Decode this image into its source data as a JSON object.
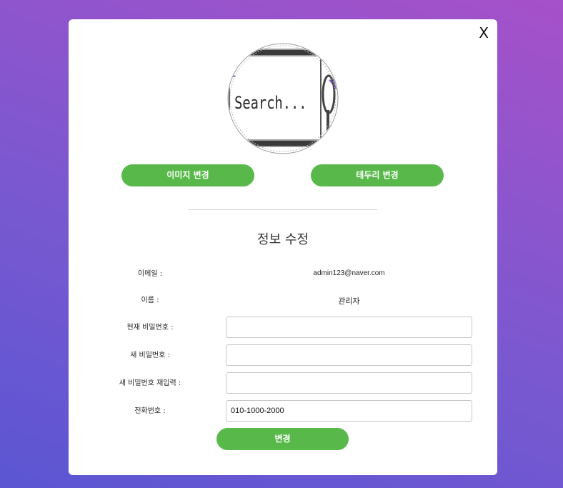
{
  "modal": {
    "close_label": "X",
    "avatar_text": "Search...",
    "change_image_label": "이미지 변경",
    "change_border_label": "테두리 변경",
    "section_title": "정보 수정",
    "fields": {
      "email_label": "이메일 :",
      "email_value": "admin123@naver.com",
      "name_label": "이름 :",
      "name_value": "관리자",
      "current_password_label": "현재 비밀번호 :",
      "current_password_value": "",
      "new_password_label": "새 비밀번호 :",
      "new_password_value": "",
      "confirm_password_label": "새 비밀번호 재입력 :",
      "confirm_password_value": "",
      "phone_label": "전화번호 :",
      "phone_value": "010-1000-2000"
    },
    "submit_label": "변경"
  },
  "colors": {
    "accent_green": "#58b94a",
    "background_start": "#5b56d3",
    "background_end": "#a651c9"
  }
}
